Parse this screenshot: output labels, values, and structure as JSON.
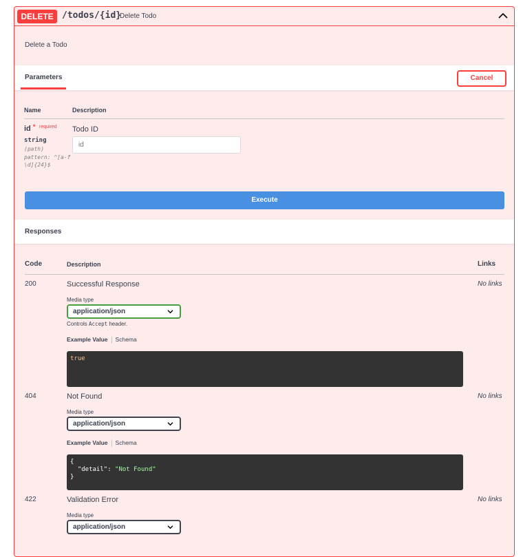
{
  "operation": {
    "method": "DELETE",
    "path": "/todos/{id}",
    "summary": "Delete Todo",
    "description": "Delete a Todo"
  },
  "parameters": {
    "tab_label": "Parameters",
    "cancel_label": "Cancel",
    "col_name": "Name",
    "col_description": "Description",
    "items": [
      {
        "name": "id",
        "required_star": "*",
        "required_label": "required",
        "type": "string",
        "in": "(path)",
        "pattern": "pattern: ^[a-f\\d]{24}$",
        "description": "Todo ID",
        "placeholder": "id"
      }
    ]
  },
  "execute_label": "Execute",
  "responses": {
    "title": "Responses",
    "col_code": "Code",
    "col_description": "Description",
    "col_links": "Links",
    "media_type_label": "Media type",
    "controls_prefix": "Controls",
    "controls_code": "Accept",
    "controls_suffix": "header.",
    "tab_example": "Example Value",
    "tab_schema": "Schema",
    "items": [
      {
        "code": "200",
        "description": "Successful Response",
        "links": "No links",
        "media_type": "application/json",
        "example_bool": "true"
      },
      {
        "code": "404",
        "description": "Not Found",
        "links": "No links",
        "media_type": "application/json",
        "example_open": "{",
        "example_key": "\"detail\"",
        "example_colon": ": ",
        "example_value": "\"Not Found\"",
        "example_close": "}"
      },
      {
        "code": "422",
        "description": "Validation Error",
        "links": "No links",
        "media_type": "application/json"
      }
    ]
  }
}
